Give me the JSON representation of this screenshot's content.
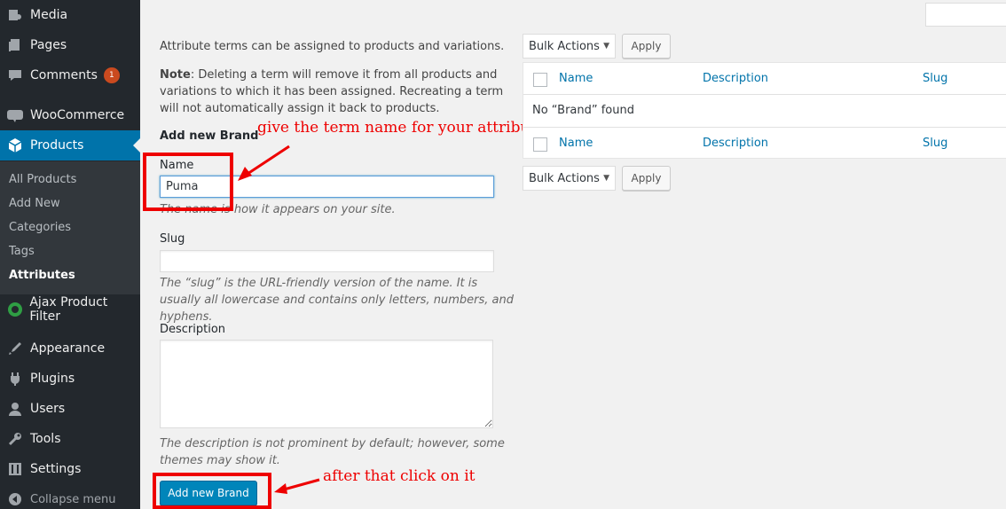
{
  "sidebar": {
    "items": [
      {
        "label": "Media",
        "icon": "media-icon"
      },
      {
        "label": "Pages",
        "icon": "pages-icon"
      },
      {
        "label": "Comments",
        "icon": "comments-icon",
        "badge": "1"
      },
      {
        "label": "WooCommerce",
        "icon": "woocommerce-icon"
      },
      {
        "label": "Products",
        "icon": "products-icon"
      },
      {
        "label": "Ajax Product Filter",
        "icon": "ajax-filter-icon"
      },
      {
        "label": "Appearance",
        "icon": "appearance-icon"
      },
      {
        "label": "Plugins",
        "icon": "plugins-icon"
      },
      {
        "label": "Users",
        "icon": "users-icon"
      },
      {
        "label": "Tools",
        "icon": "tools-icon"
      },
      {
        "label": "Settings",
        "icon": "settings-icon"
      }
    ],
    "submenu": [
      "All Products",
      "Add New",
      "Categories",
      "Tags",
      "Attributes"
    ],
    "collapse_label": "Collapse menu"
  },
  "form": {
    "intro": "Attribute terms can be assigned to products and variations.",
    "note_prefix": "Note",
    "note_body": ": Deleting a term will remove it from all products and variations to which it has been assigned. Recreating a term will not automatically assign it back to products.",
    "heading": "Add new Brand",
    "name_label": "Name",
    "name_value": "Puma",
    "name_desc": "The name is how it appears on your site.",
    "slug_label": "Slug",
    "slug_value": "",
    "slug_desc": "The “slug” is the URL-friendly version of the name. It is usually all lowercase and contains only letters, numbers, and hyphens.",
    "description_label": "Description",
    "description_value": "",
    "description_desc": "The description is not prominent by default; however, some themes may show it.",
    "submit_label": "Add new Brand"
  },
  "annotations": {
    "name_hint": "give the term name for your attribute",
    "submit_hint": "after that click on it",
    "color": "#e00000"
  },
  "table": {
    "bulk_actions_label": "Bulk Actions",
    "apply_label": "Apply",
    "columns": [
      "Name",
      "Description",
      "Slug"
    ],
    "empty_message": "No “Brand” found"
  },
  "colors": {
    "sidebar_bg": "#23282d",
    "submenu_bg": "#32373c",
    "accent": "#0073aa",
    "primary_button": "#0085ba",
    "badge": "#ca4a1f"
  }
}
